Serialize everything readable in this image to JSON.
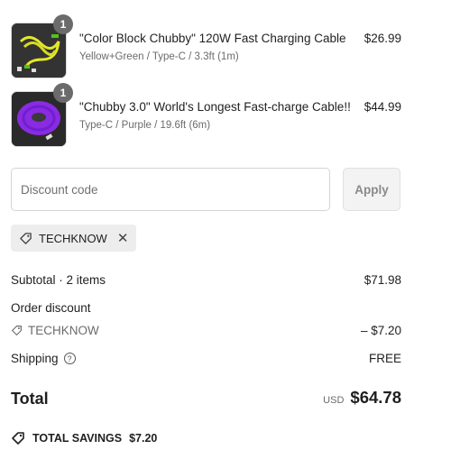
{
  "items": [
    {
      "quantity": "1",
      "title": "\"Color Block Chubby\" 120W Fast Charging Cable",
      "variant": "Yellow+Green / Type-C / 3.3ft (1m)",
      "price": "$26.99",
      "thumb_color": "#e3e72a",
      "thumb_accent": "#53c21d"
    },
    {
      "quantity": "1",
      "title": "\"Chubby 3.0\" World's Longest Fast-charge Cable!!",
      "variant": "Type-C / Purple / 19.6ft (6m)",
      "price": "$44.99",
      "thumb_color": "#8a2be2",
      "thumb_accent": "#6f1fd1"
    }
  ],
  "discount": {
    "placeholder": "Discount code",
    "apply_label": "Apply",
    "applied_code": "TECHKNOW"
  },
  "summary": {
    "subtotal_label": "Subtotal · 2 items",
    "subtotal_value": "$71.98",
    "order_discount_label": "Order discount",
    "discount_code": "TECHKNOW",
    "discount_value": "– $7.20",
    "shipping_label": "Shipping",
    "shipping_value": "FREE",
    "total_label": "Total",
    "currency": "USD",
    "total_value": "$64.78",
    "savings_label": "TOTAL SAVINGS",
    "savings_value": "$7.20"
  },
  "colors": {
    "text": "#1f1f1f",
    "muted": "#6b6b6b",
    "badge": "#6b6b6b",
    "chip_bg": "#ededed"
  }
}
